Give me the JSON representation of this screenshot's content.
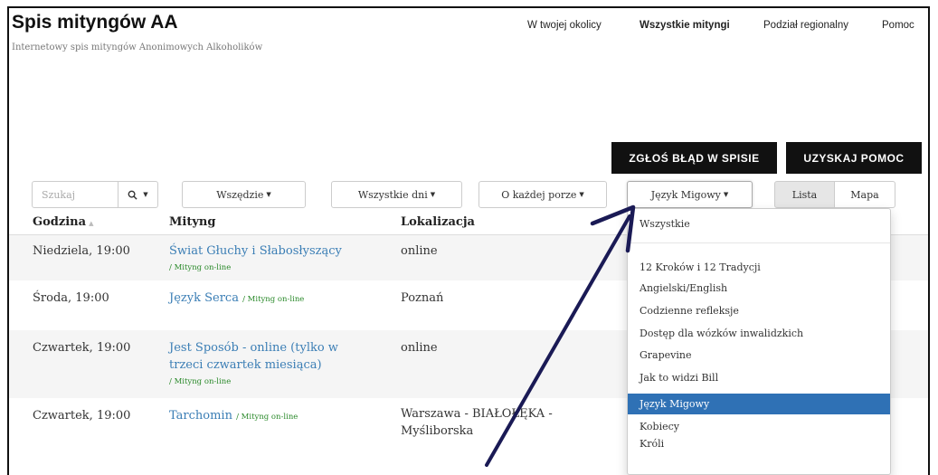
{
  "header": {
    "title": "Spis mityngów AA",
    "subtitle": "Internetowy spis mityngów Anonimowych Alkoholików",
    "nav": [
      "W twojej okolicy",
      "Wszystkie mityngi",
      "Podział regionalny",
      "Pomoc"
    ],
    "active_nav": "Wszystkie mityngi"
  },
  "actions": {
    "report": "ZGŁOŚ BŁĄD W SPISIE",
    "help": "UZYSKAJ POMOC"
  },
  "filters": {
    "search_placeholder": "Szukaj",
    "where": "Wszędzie",
    "days": "Wszystkie dni",
    "time": "O każdej porze",
    "type": "Język Migowy",
    "view_list": "Lista",
    "view_map": "Mapa"
  },
  "table": {
    "headers": [
      "Godzina",
      "Mityng",
      "Lokalizacja"
    ],
    "rows": [
      {
        "time": "Niedziela, 19:00",
        "name": "Świat Głuchy i Słabosłyszący",
        "type": "/ Mityng on-line",
        "location": "online"
      },
      {
        "time": "Środa, 19:00",
        "name": "Język Serca",
        "type": "/ Mityng on-line",
        "location": "Poznań"
      },
      {
        "time": "Czwartek, 19:00",
        "name": "Jest Sposób - online (tylko w trzeci czwartek miesiąca)",
        "name_line1": "Jest Sposób - online (tylko w",
        "name_line2": "trzeci czwartek miesiąca)",
        "type": "/ Mityng on-line",
        "location": "online"
      },
      {
        "time": "Czwartek, 19:00",
        "name": "Tarchomin",
        "type": "/ Mityng on-line",
        "location": "Warszawa - BIAŁOŁĘKA - Myśliborska",
        "location_line1": "Warszawa - BIAŁOŁĘKA -",
        "location_line2": "Myśliborska"
      }
    ]
  },
  "dropdown": {
    "items": [
      "Wszystkie",
      "12 Kroków i 12 Tradycji",
      "Angielski/English",
      "Codzienne refleksje",
      "Dostęp dla wózków inwalidzkich",
      "Grapevine",
      "Jak to widzi Bill",
      "Język Migowy",
      "Kobiecy",
      "Króli"
    ],
    "selected": "Język Migowy"
  },
  "colors": {
    "link": "#3b7eb5",
    "online_tag": "#2b8a2b",
    "selected_bg": "#2f71b5",
    "button_dark": "#111111",
    "arrow": "#1a1a55"
  }
}
